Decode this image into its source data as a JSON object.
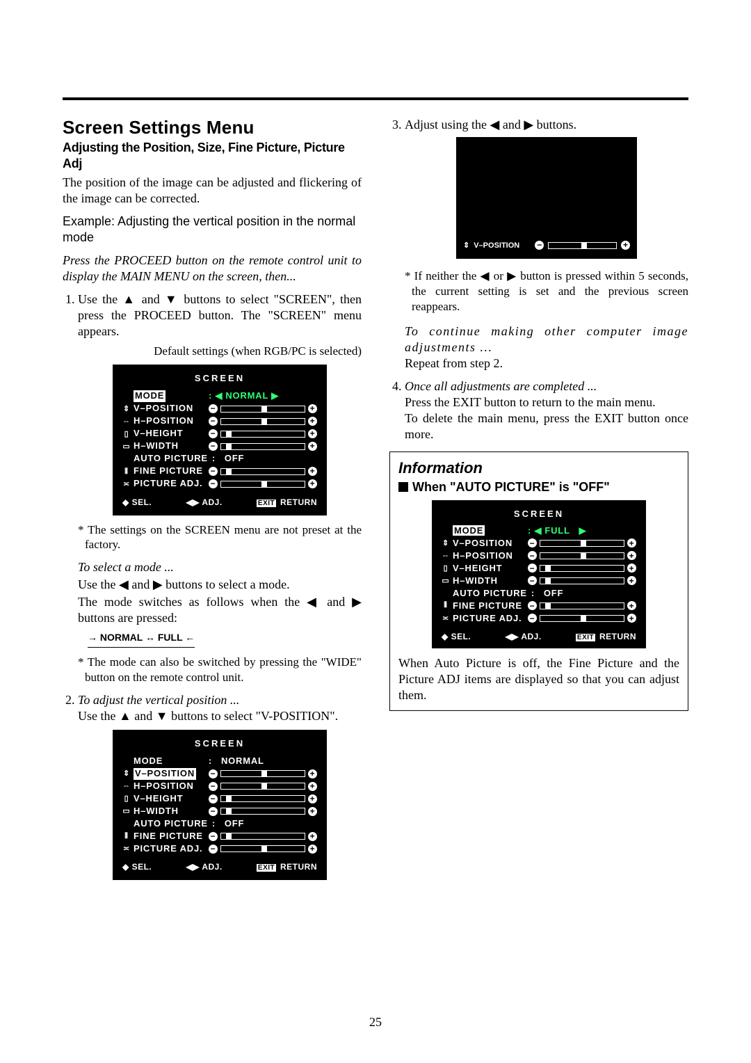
{
  "page_number": "25",
  "heading": "Screen Settings Menu",
  "subheading": "Adjusting the Position, Size, Fine Picture, Picture Adj",
  "intro": "The position of the image can be adjusted and flickering of the image can be corrected.",
  "example_label": "Example: Adjusting the vertical position in the normal mode",
  "press_proceed": "Press the PROCEED button on the remote control unit to display the MAIN MENU on the screen, then...",
  "step1": "Use the ▲ and ▼ buttons to select \"SCREEN\", then press the PROCEED button. The \"SCREEN\" menu appears.",
  "default_settings_label": "Default settings (when RGB/PC is selected)",
  "osd": {
    "title": "SCREEN",
    "mode_label": "MODE",
    "mode_value_normal": "NORMAL",
    "mode_value_full": "FULL",
    "vpos": "V–POSITION",
    "hpos": "H–POSITION",
    "vheight": "V–HEIGHT",
    "hwidth": "H–WIDTH",
    "auto_picture": "AUTO PICTURE",
    "auto_picture_value": "OFF",
    "fine_picture": "FINE PICTURE",
    "picture_adj": "PICTURE ADJ.",
    "footer_sel": "SEL.",
    "footer_adj": "ADJ.",
    "footer_exit": "EXIT",
    "footer_return": "RETURN"
  },
  "note_factory": "*  The settings on the SCREEN menu are not preset at the factory.",
  "to_select_mode": "To select a mode ...",
  "use_lr_mode": "Use the ◀ and ▶ buttons to select a mode.",
  "mode_switch_sentence": "The mode switches as follows when the ◀ and ▶ buttons are pressed:",
  "mode_cycle": "→ NORMAL ↔ FULL ←",
  "wide_note": "*  The mode can also be switched by pressing the \"WIDE\" button on the remote control unit.",
  "step2_title": "To adjust the vertical position ...",
  "step2_body": "Use the ▲ and ▼ buttons to select \"V-POSITION\".",
  "step3": "Adjust using the ◀ and ▶ buttons.",
  "timeout_note": "*  If neither the ◀ or ▶ button is pressed within 5 seconds, the current setting is set and the previous screen reappears.",
  "continue_label": "To continue making other computer image adjustments ...",
  "repeat_step2": "Repeat from step 2.",
  "step4_title": "Once all adjustments are completed ...",
  "step4_body1": "Press the EXIT button to return to the main menu.",
  "step4_body2": "To delete the main menu, press the EXIT button once more.",
  "info_heading": "Information",
  "info_sub": "When \"AUTO PICTURE\" is \"OFF\"",
  "info_body": "When Auto Picture is off, the Fine Picture and the Picture ADJ items are displayed so that you can adjust them."
}
